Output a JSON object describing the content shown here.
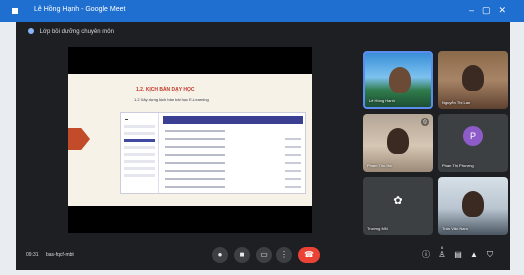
{
  "window": {
    "title": "Lê Hồng Hạnh - Google Meet"
  },
  "meeting": {
    "name": "Lớp bồi dưỡng chuyên môn"
  },
  "slide": {
    "heading": "1.2. KỊCH BẢN DẠY HỌC",
    "subheading": "1.2 Xây dựng kịch bản bài học E-Learning"
  },
  "participants": [
    {
      "name": "Lê Hồng Hạnh",
      "active": true
    },
    {
      "name": "Nguyễn Thị Lan"
    },
    {
      "name": "Phạm Thu Hà",
      "muted": true
    },
    {
      "name": "Phan Thị Phượng",
      "initial": "P"
    },
    {
      "name": "Trường MN"
    },
    {
      "name": "Trần Văn Nam"
    }
  ],
  "controls": {
    "time": "09:31",
    "meeting_code": "bas-fqcf-mbt",
    "participant_count": "6"
  },
  "colors": {
    "titlebar": "#1f6fd1",
    "meet_bg": "#1e1f22",
    "end_call": "#ea4335",
    "active_speaker": "#5b8def"
  },
  "icons": {
    "mic": "mic-icon",
    "camera": "camera-icon",
    "captions": "captions-icon",
    "raise_hand": "raise-hand-icon",
    "end_call": "end-call-icon",
    "info": "info-icon",
    "people": "people-icon",
    "chat": "chat-icon",
    "activities": "activities-icon",
    "host_controls": "shield-icon"
  }
}
